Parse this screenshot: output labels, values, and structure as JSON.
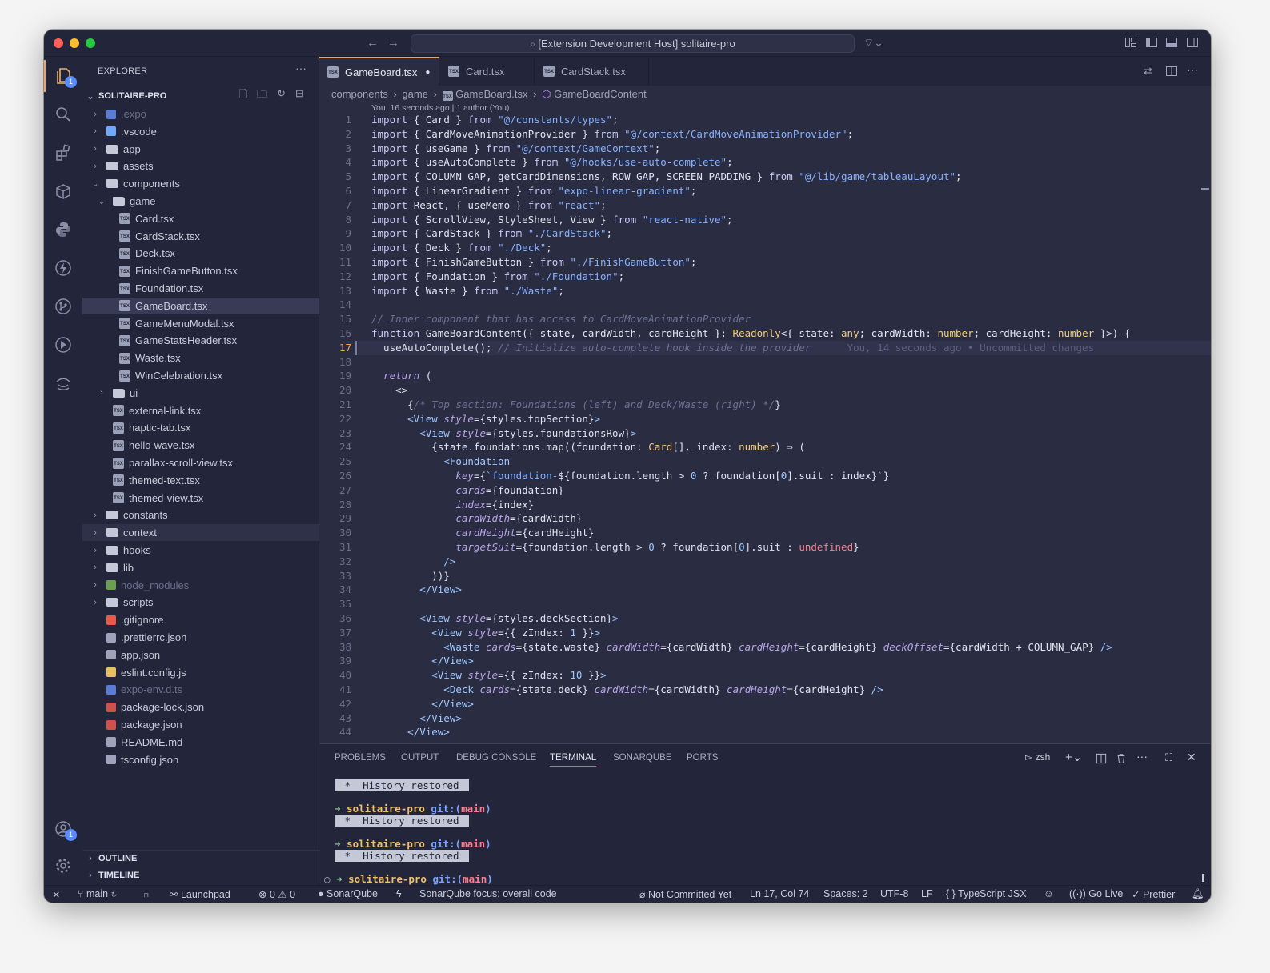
{
  "window": {
    "title": "[Extension Development Host] solitaire-pro"
  },
  "activity": {
    "explorer_badge": "1",
    "account_badge": "1"
  },
  "explorer": {
    "header": "EXPLORER",
    "project": "SOLITAIRE-PRO",
    "items": [
      {
        "label": ".expo",
        "depth": 0,
        "kind": "expo",
        "chev": "›",
        "dim": true
      },
      {
        "label": ".vscode",
        "depth": 0,
        "kind": "vscode",
        "chev": "›"
      },
      {
        "label": "app",
        "depth": 0,
        "kind": "folder",
        "chev": "›"
      },
      {
        "label": "assets",
        "depth": 0,
        "kind": "folder",
        "chev": "›"
      },
      {
        "label": "components",
        "depth": 0,
        "kind": "folder",
        "chev": "⌄"
      },
      {
        "label": "game",
        "depth": 1,
        "kind": "folder",
        "chev": "⌄"
      },
      {
        "label": "Card.tsx",
        "depth": 2,
        "kind": "tsx"
      },
      {
        "label": "CardStack.tsx",
        "depth": 2,
        "kind": "tsx"
      },
      {
        "label": "Deck.tsx",
        "depth": 2,
        "kind": "tsx"
      },
      {
        "label": "FinishGameButton.tsx",
        "depth": 2,
        "kind": "tsx"
      },
      {
        "label": "Foundation.tsx",
        "depth": 2,
        "kind": "tsx"
      },
      {
        "label": "GameBoard.tsx",
        "depth": 2,
        "kind": "tsx",
        "selected": true
      },
      {
        "label": "GameMenuModal.tsx",
        "depth": 2,
        "kind": "tsx"
      },
      {
        "label": "GameStatsHeader.tsx",
        "depth": 2,
        "kind": "tsx"
      },
      {
        "label": "Waste.tsx",
        "depth": 2,
        "kind": "tsx"
      },
      {
        "label": "WinCelebration.tsx",
        "depth": 2,
        "kind": "tsx"
      },
      {
        "label": "ui",
        "depth": 1,
        "kind": "folder",
        "chev": "›"
      },
      {
        "label": "external-link.tsx",
        "depth": 1,
        "kind": "tsx"
      },
      {
        "label": "haptic-tab.tsx",
        "depth": 1,
        "kind": "tsx"
      },
      {
        "label": "hello-wave.tsx",
        "depth": 1,
        "kind": "tsx"
      },
      {
        "label": "parallax-scroll-view.tsx",
        "depth": 1,
        "kind": "tsx"
      },
      {
        "label": "themed-text.tsx",
        "depth": 1,
        "kind": "tsx"
      },
      {
        "label": "themed-view.tsx",
        "depth": 1,
        "kind": "tsx"
      },
      {
        "label": "constants",
        "depth": 0,
        "kind": "folder",
        "chev": "›"
      },
      {
        "label": "context",
        "depth": 0,
        "kind": "folder",
        "chev": "›",
        "hover": true
      },
      {
        "label": "hooks",
        "depth": 0,
        "kind": "folder",
        "chev": "›"
      },
      {
        "label": "lib",
        "depth": 0,
        "kind": "folder",
        "chev": "›"
      },
      {
        "label": "node_modules",
        "depth": 0,
        "kind": "node",
        "chev": "›",
        "dim": true
      },
      {
        "label": "scripts",
        "depth": 0,
        "kind": "folder",
        "chev": "›"
      },
      {
        "label": ".gitignore",
        "depth": 0,
        "kind": "git"
      },
      {
        "label": ".prettierrc.json",
        "depth": 0,
        "kind": "prettier"
      },
      {
        "label": "app.json",
        "depth": 0,
        "kind": "appjson"
      },
      {
        "label": "eslint.config.js",
        "depth": 0,
        "kind": "js"
      },
      {
        "label": "expo-env.d.ts",
        "depth": 0,
        "kind": "ts",
        "dim": true
      },
      {
        "label": "package-lock.json",
        "depth": 0,
        "kind": "npm"
      },
      {
        "label": "package.json",
        "depth": 0,
        "kind": "npm"
      },
      {
        "label": "README.md",
        "depth": 0,
        "kind": "md"
      },
      {
        "label": "tsconfig.json",
        "depth": 0,
        "kind": "tsconfig"
      }
    ],
    "outline": "OUTLINE",
    "timeline": "TIMELINE"
  },
  "tabs": [
    {
      "label": "GameBoard.tsx",
      "active": true,
      "modified": "●"
    },
    {
      "label": "Card.tsx"
    },
    {
      "label": "CardStack.tsx"
    }
  ],
  "breadcrumb": {
    "p1": "components",
    "p2": "game",
    "p3": "GameBoard.tsx",
    "p4": "GameBoardContent"
  },
  "blame_header": "You, 16 seconds ago | 1 author (You)",
  "code_lines": [
    [
      [
        "k",
        "import "
      ],
      [
        "p",
        "{ "
      ],
      [
        "p",
        "Card"
      ],
      [
        "p",
        " } "
      ],
      [
        "k",
        "from "
      ],
      [
        "s",
        "\"@/constants/types\""
      ],
      [
        "p",
        ";"
      ]
    ],
    [
      [
        "k",
        "import "
      ],
      [
        "p",
        "{ "
      ],
      [
        "p",
        "CardMoveAnimationProvider"
      ],
      [
        "p",
        " } "
      ],
      [
        "k",
        "from "
      ],
      [
        "s",
        "\"@/context/CardMoveAnimationProvider\""
      ],
      [
        "p",
        ";"
      ]
    ],
    [
      [
        "k",
        "import "
      ],
      [
        "p",
        "{ "
      ],
      [
        "p",
        "useGame"
      ],
      [
        "p",
        " } "
      ],
      [
        "k",
        "from "
      ],
      [
        "s",
        "\"@/context/GameContext\""
      ],
      [
        "p",
        ";"
      ]
    ],
    [
      [
        "k",
        "import "
      ],
      [
        "p",
        "{ "
      ],
      [
        "p",
        "useAutoComplete"
      ],
      [
        "p",
        " } "
      ],
      [
        "k",
        "from "
      ],
      [
        "s",
        "\"@/hooks/use-auto-complete\""
      ],
      [
        "p",
        ";"
      ]
    ],
    [
      [
        "k",
        "import "
      ],
      [
        "p",
        "{ "
      ],
      [
        "p",
        "COLUMN_GAP, getCardDimensions, ROW_GAP, SCREEN_PADDING"
      ],
      [
        "p",
        " } "
      ],
      [
        "k",
        "from "
      ],
      [
        "s",
        "\"@/lib/game/tableauLayout\""
      ],
      [
        "p",
        ";"
      ]
    ],
    [
      [
        "k",
        "import "
      ],
      [
        "p",
        "{ "
      ],
      [
        "p",
        "LinearGradient"
      ],
      [
        "p",
        " } "
      ],
      [
        "k",
        "from "
      ],
      [
        "s",
        "\"expo-linear-gradient\""
      ],
      [
        "p",
        ";"
      ]
    ],
    [
      [
        "k",
        "import "
      ],
      [
        "p",
        "React, { useMemo } "
      ],
      [
        "k",
        "from "
      ],
      [
        "s",
        "\"react\""
      ],
      [
        "p",
        ";"
      ]
    ],
    [
      [
        "k",
        "import "
      ],
      [
        "p",
        "{ "
      ],
      [
        "p",
        "ScrollView, StyleSheet, View"
      ],
      [
        "p",
        " } "
      ],
      [
        "k",
        "from "
      ],
      [
        "s",
        "\"react-native\""
      ],
      [
        "p",
        ";"
      ]
    ],
    [
      [
        "k",
        "import "
      ],
      [
        "p",
        "{ "
      ],
      [
        "p",
        "CardStack"
      ],
      [
        "p",
        " } "
      ],
      [
        "k",
        "from "
      ],
      [
        "s",
        "\"./CardStack\""
      ],
      [
        "p",
        ";"
      ]
    ],
    [
      [
        "k",
        "import "
      ],
      [
        "p",
        "{ "
      ],
      [
        "p",
        "Deck"
      ],
      [
        "p",
        " } "
      ],
      [
        "k",
        "from "
      ],
      [
        "s",
        "\"./Deck\""
      ],
      [
        "p",
        ";"
      ]
    ],
    [
      [
        "k",
        "import "
      ],
      [
        "p",
        "{ "
      ],
      [
        "p",
        "FinishGameButton"
      ],
      [
        "p",
        " } "
      ],
      [
        "k",
        "from "
      ],
      [
        "s",
        "\"./FinishGameButton\""
      ],
      [
        "p",
        ";"
      ]
    ],
    [
      [
        "k",
        "import "
      ],
      [
        "p",
        "{ "
      ],
      [
        "p",
        "Foundation"
      ],
      [
        "p",
        " } "
      ],
      [
        "k",
        "from "
      ],
      [
        "s",
        "\"./Foundation\""
      ],
      [
        "p",
        ";"
      ]
    ],
    [
      [
        "k",
        "import "
      ],
      [
        "p",
        "{ "
      ],
      [
        "p",
        "Waste"
      ],
      [
        "p",
        " } "
      ],
      [
        "k",
        "from "
      ],
      [
        "s",
        "\"./Waste\""
      ],
      [
        "p",
        ";"
      ]
    ],
    [],
    [
      [
        "c",
        "// Inner component that has access to CardMoveAnimationProvider"
      ]
    ],
    [
      [
        "k",
        "function "
      ],
      [
        "p",
        "GameBoardContent({ state, cardWidth, cardHeight }: "
      ],
      [
        "ty",
        "Readonly"
      ],
      [
        "p",
        "<{ state: "
      ],
      [
        "ty",
        "any"
      ],
      [
        "p",
        "; cardWidth: "
      ],
      [
        "ty",
        "number"
      ],
      [
        "p",
        "; cardHeight: "
      ],
      [
        "ty",
        "number"
      ],
      [
        "p",
        " }>) {"
      ]
    ],
    [
      [
        "p",
        "  useAutoComplete(); "
      ],
      [
        "c",
        "// Initialize auto-complete hook inside the provider"
      ],
      [
        "g",
        "      You, 14 seconds ago • Uncommitted changes"
      ]
    ],
    [],
    [
      [
        "a",
        "  return"
      ],
      [
        "p",
        " ("
      ]
    ],
    [
      [
        "p",
        "    <>"
      ]
    ],
    [
      [
        "p",
        "      {"
      ],
      [
        "c",
        "/* Top section: Foundations (left) and Deck/Waste (right) */"
      ],
      [
        "p",
        "}"
      ]
    ],
    [
      [
        "t",
        "      <View "
      ],
      [
        "a",
        "style"
      ],
      [
        "p",
        "={styles.topSection}"
      ],
      [
        "t",
        ">"
      ]
    ],
    [
      [
        "t",
        "        <View "
      ],
      [
        "a",
        "style"
      ],
      [
        "p",
        "={styles.foundationsRow}"
      ],
      [
        "t",
        ">"
      ]
    ],
    [
      [
        "p",
        "          {state.foundations.map((foundation: "
      ],
      [
        "ty",
        "Card"
      ],
      [
        "p",
        "[], index: "
      ],
      [
        "ty",
        "number"
      ],
      [
        "p",
        ") ⇒ ("
      ]
    ],
    [
      [
        "t",
        "            <Foundation"
      ]
    ],
    [
      [
        "a",
        "              key"
      ],
      [
        "p",
        "={"
      ],
      [
        "s",
        "`foundation-"
      ],
      [
        "p",
        "${foundation.length > "
      ],
      [
        "n",
        "0"
      ],
      [
        "p",
        " ? foundation["
      ],
      [
        "n",
        "0"
      ],
      [
        "p",
        "].suit : index}"
      ],
      [
        "s",
        "`"
      ],
      [
        "p",
        "}"
      ]
    ],
    [
      [
        "a",
        "              cards"
      ],
      [
        "p",
        "={foundation}"
      ]
    ],
    [
      [
        "a",
        "              index"
      ],
      [
        "p",
        "={index}"
      ]
    ],
    [
      [
        "a",
        "              cardWidth"
      ],
      [
        "p",
        "={cardWidth}"
      ]
    ],
    [
      [
        "a",
        "              cardHeight"
      ],
      [
        "p",
        "={cardHeight}"
      ]
    ],
    [
      [
        "a",
        "              targetSuit"
      ],
      [
        "p",
        "={foundation.length > "
      ],
      [
        "n",
        "0"
      ],
      [
        "p",
        " ? foundation["
      ],
      [
        "n",
        "0"
      ],
      [
        "p",
        "].suit : "
      ],
      [
        "u",
        "undefined"
      ],
      [
        "p",
        "}"
      ]
    ],
    [
      [
        "t",
        "            />"
      ]
    ],
    [
      [
        "p",
        "          ))}"
      ]
    ],
    [
      [
        "t",
        "        </View>"
      ]
    ],
    [],
    [
      [
        "t",
        "        <View "
      ],
      [
        "a",
        "style"
      ],
      [
        "p",
        "={styles.deckSection}"
      ],
      [
        "t",
        ">"
      ]
    ],
    [
      [
        "t",
        "          <View "
      ],
      [
        "a",
        "style"
      ],
      [
        "p",
        "={{ zIndex: "
      ],
      [
        "n",
        "1"
      ],
      [
        "p",
        " }}"
      ],
      [
        "t",
        ">"
      ]
    ],
    [
      [
        "t",
        "            <Waste "
      ],
      [
        "a",
        "cards"
      ],
      [
        "p",
        "={state.waste} "
      ],
      [
        "a",
        "cardWidth"
      ],
      [
        "p",
        "={cardWidth} "
      ],
      [
        "a",
        "cardHeight"
      ],
      [
        "p",
        "={cardHeight} "
      ],
      [
        "a",
        "deckOffset"
      ],
      [
        "p",
        "={cardWidth + COLUMN_GAP} "
      ],
      [
        "t",
        "/>"
      ]
    ],
    [
      [
        "t",
        "          </View>"
      ]
    ],
    [
      [
        "t",
        "          <View "
      ],
      [
        "a",
        "style"
      ],
      [
        "p",
        "={{ zIndex: "
      ],
      [
        "n",
        "10"
      ],
      [
        "p",
        " }}"
      ],
      [
        "t",
        ">"
      ]
    ],
    [
      [
        "t",
        "            <Deck "
      ],
      [
        "a",
        "cards"
      ],
      [
        "p",
        "={state.deck} "
      ],
      [
        "a",
        "cardWidth"
      ],
      [
        "p",
        "={cardWidth} "
      ],
      [
        "a",
        "cardHeight"
      ],
      [
        "p",
        "={cardHeight} "
      ],
      [
        "t",
        "/>"
      ]
    ],
    [
      [
        "t",
        "          </View>"
      ]
    ],
    [
      [
        "t",
        "        </View>"
      ]
    ],
    [
      [
        "t",
        "      </View>"
      ]
    ]
  ],
  "current_line": 17,
  "panel": {
    "tabs": [
      "PROBLEMS",
      "OUTPUT",
      "DEBUG CONSOLE",
      "TERMINAL",
      "SONARQUBE",
      "PORTS"
    ],
    "active_tab": "TERMINAL",
    "shell": "zsh",
    "history": " *  History restored ",
    "arrow": "➜",
    "dir": "solitaire-pro",
    "git": " git:(",
    "branch": "main",
    "close_paren": ")"
  },
  "status": {
    "branch": "main",
    "launchpad": "Launchpad",
    "errors": "0",
    "warnings": "0",
    "sonar": "SonarQube",
    "sonar_focus": "SonarQube focus: overall code",
    "commit": "Not Committed Yet",
    "position": "Ln 17, Col 74",
    "spaces": "Spaces: 2",
    "encoding": "UTF-8",
    "eol": "LF",
    "language": "TypeScript JSX",
    "golive": "Go Live",
    "prettier": "Prettier"
  },
  "colors": {
    "accent": "#5a8cff",
    "tab_active_border": "#f0a35e",
    "keyword": "#c6c9f5",
    "string": "#86b0ff",
    "type": "#f2c97d"
  }
}
